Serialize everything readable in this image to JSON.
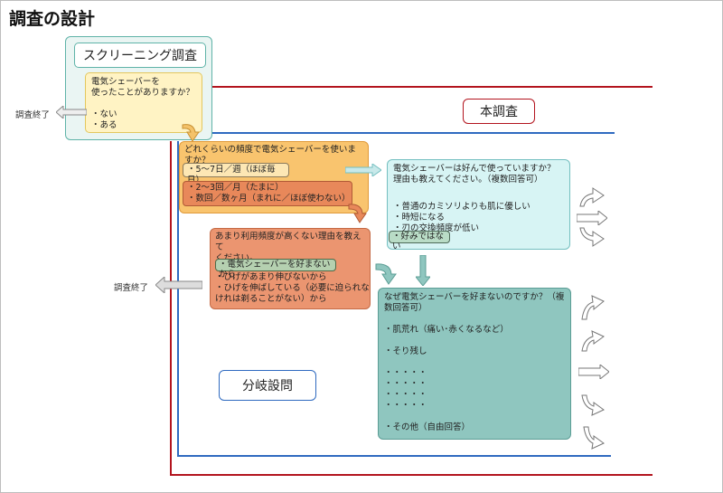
{
  "title": "調査の設計",
  "screening": {
    "title": "スクリーニング調査",
    "question_lines": [
      "電気シェーバーを",
      "使ったことがありますか？"
    ],
    "options": [
      "・ない",
      "・ある"
    ]
  },
  "end_label_1": "調査終了",
  "end_label_2": "調査終了",
  "main_survey_label": "本調査",
  "branch_label": "分岐設問",
  "frequency": {
    "question": "どれくらいの頻度で電気シェーバーを使いますか？",
    "option_1": "・5〜7日／週（ほぼ毎日）",
    "option_2_lines": [
      "・2〜3回／月（たまに）",
      "・数回／数ヶ月（まれに／ほぼ使わない）"
    ]
  },
  "reason": {
    "question_lines": [
      "あまり利用頻度が高くない理由を教えて",
      "ください。"
    ],
    "option_selected": "・電気シェーバーを好まないから",
    "other_lines": [
      "・ひげがあまり伸びないから",
      "・ひげを伸ばしている（必要に迫られな",
      "けれは剃ることがない）から"
    ]
  },
  "like": {
    "question_lines": [
      "電気シェーバーは好んで使っていますか？",
      "理由も教えてください。（複数回答可）"
    ],
    "option_lines": [
      "・普通のカミソリよりも肌に優しい",
      "・時短になる",
      "・刃の交換頻度が低い"
    ],
    "option_selected": "・好みではない"
  },
  "why_not": {
    "question_lines": [
      "なぜ電気シェーバーを好まないのですか？（複",
      "数回答可）"
    ],
    "option_1": "・肌荒れ（痛い･赤くなるなど）",
    "option_2": "・そり残し",
    "ellipsis_lines": [
      "・・・・・",
      "・・・・・",
      "・・・・・",
      "・・・・・"
    ],
    "option_other": "・その他（自由回答）"
  },
  "colors": {
    "main_survey_line": "#b3141e",
    "branch_line": "#2f6ac0",
    "screening_border": "#5fb3a8",
    "arrow_teal": "#8fc6bf",
    "arrow_orange": "#f0a05a"
  }
}
